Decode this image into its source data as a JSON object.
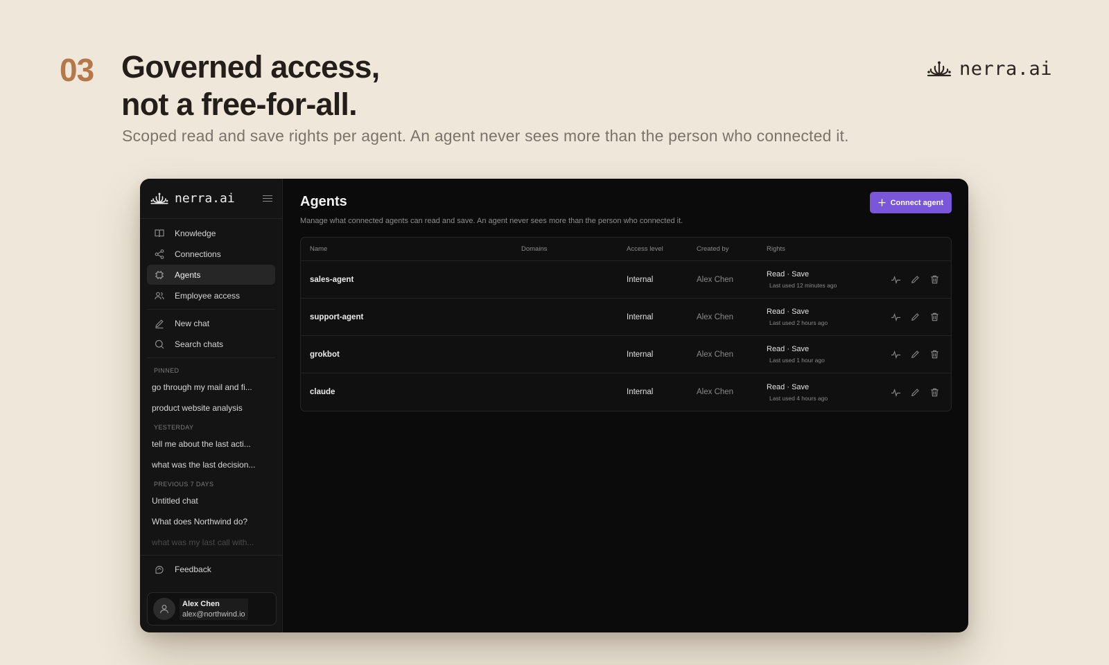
{
  "hero": {
    "step": "03",
    "headline_line1": "Governed access,",
    "headline_line2": "not a free-for-all.",
    "subline": "Scoped read and save rights per agent. An agent never sees more than the person who connected it.",
    "brand": "nerra.ai"
  },
  "sidebar": {
    "brand": "nerra.ai",
    "nav": [
      {
        "label": "Knowledge",
        "icon": "book-icon"
      },
      {
        "label": "Connections",
        "icon": "share-icon"
      },
      {
        "label": "Agents",
        "icon": "chip-icon",
        "active": true
      },
      {
        "label": "Employee access",
        "icon": "users-icon"
      }
    ],
    "actions": [
      {
        "label": "New chat",
        "icon": "pencil-icon"
      },
      {
        "label": "Search chats",
        "icon": "search-icon"
      }
    ],
    "sections": {
      "pinned": "PINNED",
      "yesterday": "YESTERDAY",
      "previous": "PREVIOUS 7 DAYS"
    },
    "pinned": [
      "go through my mail and fi...",
      "product website analysis"
    ],
    "yesterday": [
      "tell me about the last acti...",
      "what was the last decision..."
    ],
    "previous": [
      "Untitled chat",
      "What does Northwind do?",
      "what was my last call with..."
    ],
    "feedback": "Feedback",
    "user": {
      "name": "Alex Chen",
      "email": "alex@northwind.io"
    }
  },
  "main": {
    "title": "Agents",
    "description": "Manage what connected agents can read and save. An agent never sees more than the person who connected it.",
    "connect_button": "Connect agent",
    "columns": {
      "name": "Name",
      "domains": "Domains",
      "access": "Access level",
      "created_by": "Created by",
      "rights": "Rights"
    },
    "rows": [
      {
        "name": "sales-agent",
        "domains": "",
        "access": "Internal",
        "created_by": "Alex Chen",
        "rights": "Read · Save",
        "last_used": "Last used 12 minutes ago"
      },
      {
        "name": "support-agent",
        "domains": "",
        "access": "Internal",
        "created_by": "Alex Chen",
        "rights": "Read · Save",
        "last_used": "Last used 2 hours ago"
      },
      {
        "name": "grokbot",
        "domains": "",
        "access": "Internal",
        "created_by": "Alex Chen",
        "rights": "Read · Save",
        "last_used": "Last used 1 hour ago"
      },
      {
        "name": "claude",
        "domains": "",
        "access": "Internal",
        "created_by": "Alex Chen",
        "rights": "Read · Save",
        "last_used": "Last used 4 hours ago"
      }
    ]
  },
  "colors": {
    "background": "#efe8da",
    "accent_number": "#b4784a",
    "primary_button": "#7a56d8",
    "window": "#0b0b0b"
  }
}
